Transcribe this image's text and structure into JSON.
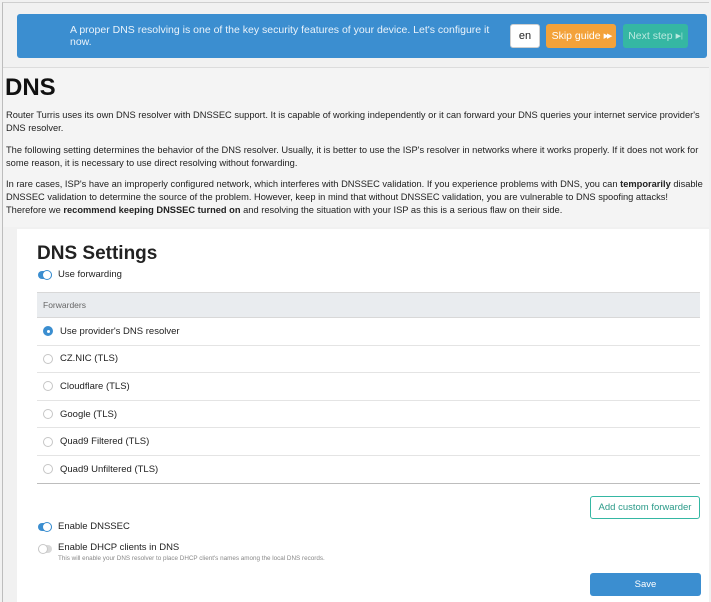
{
  "banner": {
    "text": "A proper DNS resolving is one of the key security features of your device. Let's configure it now.",
    "lang_label": "en",
    "skip_label": "Skip guide",
    "skip_icon": "▶▶",
    "next_label": "Next step",
    "next_icon": "▶|",
    "colors": {
      "banner": "#3b8ed0",
      "skip": "#f3a23a",
      "next": "#35b7a3"
    }
  },
  "intro": {
    "title": "DNS",
    "p1": "Router Turris uses its own DNS resolver with DNSSEC support. It is capable of working independently or it can forward your DNS queries your internet service provider's DNS resolver.",
    "p2": "The following setting determines the behavior of the DNS resolver. Usually, it is better to use the ISP's resolver in networks where it works properly. If it does not work for some reason, it is necessary to use direct resolving without forwarding.",
    "p3_part1": "In rare cases, ISP's have an improperly configured network, which interferes with DNSSEC validation. If you experience problems with DNS, you can ",
    "p3_bold1": "temporarily",
    "p3_part2": " disable DNSSEC validation to determine the source of the problem. However, keep in mind that without DNSSEC validation, you are vulnerable to DNS spoofing attacks! Therefore we ",
    "p3_bold2": "recommend keeping DNSSEC turned on",
    "p3_part3": " and resolving the situation with your ISP as this is a serious flaw on their side."
  },
  "settings": {
    "title": "DNS Settings",
    "use_forwarding_label": "Use forwarding",
    "use_forwarding": true,
    "forwarders_header": "Forwarders",
    "forwarders": [
      {
        "label": "Use provider's DNS resolver",
        "checked": true
      },
      {
        "label": "CZ.NIC (TLS)",
        "checked": false
      },
      {
        "label": "Cloudflare (TLS)",
        "checked": false
      },
      {
        "label": "Google (TLS)",
        "checked": false
      },
      {
        "label": "Quad9 Filtered (TLS)",
        "checked": false
      },
      {
        "label": "Quad9 Unfiltered (TLS)",
        "checked": false
      }
    ],
    "add_forwarder_label": "Add custom forwarder",
    "enable_dnssec_label": "Enable DNSSEC",
    "enable_dnssec": true,
    "dhcp_label": "Enable DHCP clients in DNS",
    "dhcp_description": "This will enable your DNS resolver to place DHCP client's names among the local DNS records.",
    "dhcp_enabled": false,
    "save_label": "Save"
  }
}
